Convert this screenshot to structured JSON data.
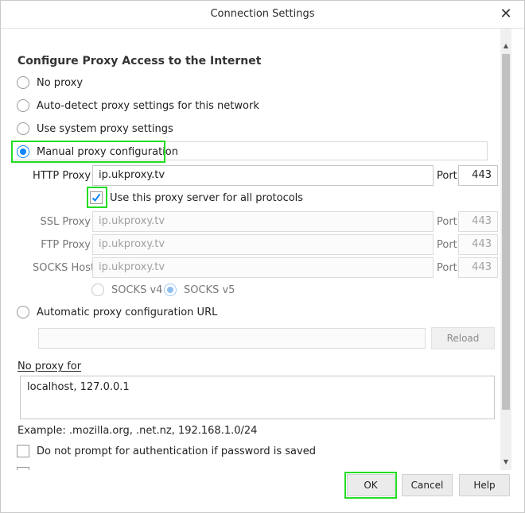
{
  "window": {
    "title": "Connection Settings",
    "close_glyph": "✕"
  },
  "section": {
    "title": "Configure Proxy Access to the Internet"
  },
  "options": {
    "no_proxy": "No proxy",
    "auto_detect": "Auto-detect proxy settings for this network",
    "system": "Use system proxy settings",
    "manual": "Manual proxy configuration",
    "auto_url": "Automatic proxy configuration URL"
  },
  "http": {
    "label": "HTTP Proxy",
    "value": "ip.ukproxy.tv",
    "port_label": "Port",
    "port_value": "443"
  },
  "share": {
    "label": "Use this proxy server for all protocols",
    "checked": true
  },
  "ssl": {
    "label": "SSL Proxy",
    "value": "ip.ukproxy.tv",
    "port_label": "Port",
    "port_value": "443"
  },
  "ftp": {
    "label": "FTP Proxy",
    "value": "ip.ukproxy.tv",
    "port_label": "Port",
    "port_value": "443"
  },
  "socks": {
    "label": "SOCKS Host",
    "value": "ip.ukproxy.tv",
    "port_label": "Port",
    "port_value": "443",
    "v4": "SOCKS v4",
    "v5": "SOCKS v5"
  },
  "auto_config": {
    "url_value": "",
    "reload_label": "Reload"
  },
  "no_proxy_for": {
    "label": "No proxy for",
    "value": "localhost, 127.0.0.1",
    "example": "Example: .mozilla.org, .net.nz, 192.168.1.0/24"
  },
  "auth": {
    "label": "Do not prompt for authentication if password is saved"
  },
  "buttons": {
    "ok": "OK",
    "cancel": "Cancel",
    "help": "Help"
  },
  "colors": {
    "accent": "#0a84ff",
    "highlight": "#22dd22"
  }
}
